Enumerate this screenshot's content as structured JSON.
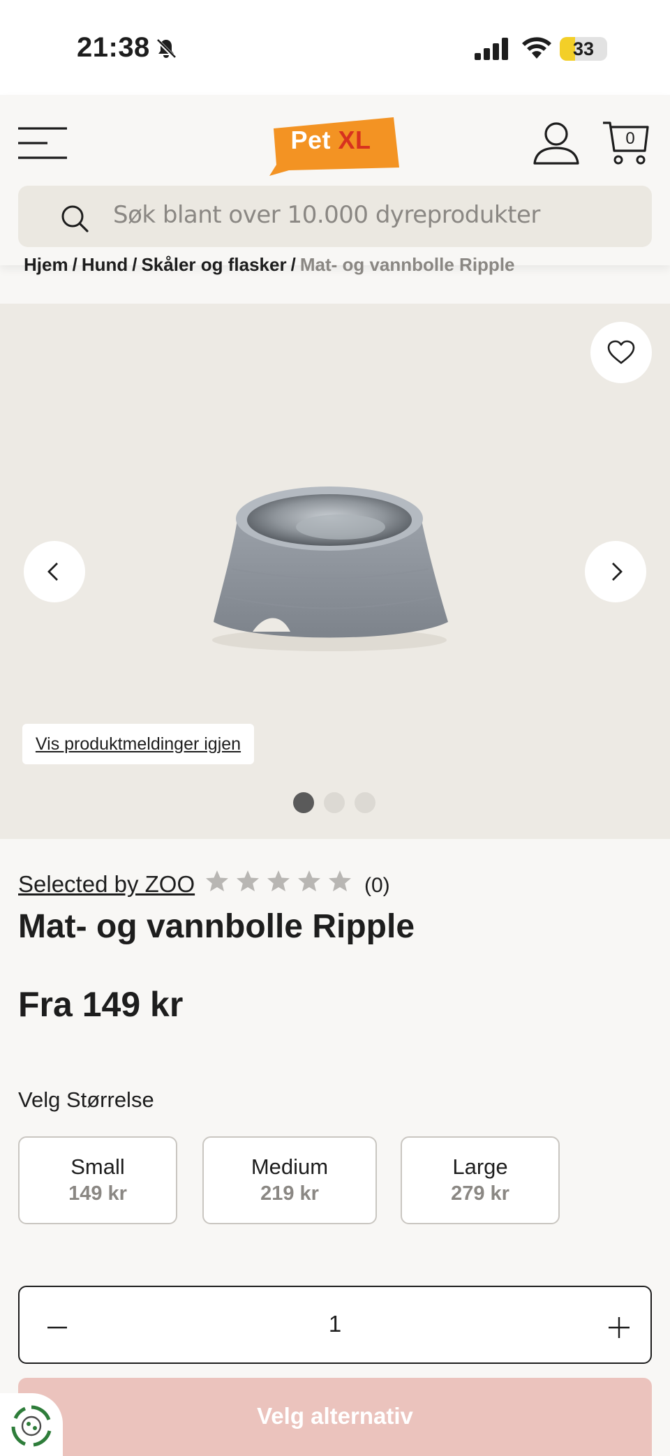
{
  "status_bar": {
    "time": "21:38",
    "battery": "33",
    "battery_level": 0.33
  },
  "header": {
    "logo": {
      "word1": "Pet",
      "word2": "XL"
    },
    "cart_count": "0",
    "icons": [
      "menu-icon",
      "user-icon",
      "cart-icon",
      "search-icon"
    ]
  },
  "search": {
    "placeholder": "Søk blant over 10.000 dyreprodukter"
  },
  "breadcrumb": {
    "items": [
      "Hjem",
      "Hund",
      "Skåler og flasker"
    ],
    "separator": "/",
    "current": "Mat- og vannbolle Ripple"
  },
  "gallery": {
    "notice_button": "Vis produktmeldinger igjen",
    "slide_count": 3,
    "active_slide": 1,
    "icons": [
      "heart-icon",
      "chevron-left-icon",
      "chevron-right-icon"
    ]
  },
  "product": {
    "brand": "Selected by ZOO",
    "rating_stars": 0,
    "rating_max": 5,
    "review_count": "(0)",
    "title": "Mat- og vannbolle Ripple",
    "price": "Fra 149 kr"
  },
  "size": {
    "label": "Velg Størrelse",
    "options": [
      {
        "name": "Small",
        "price": "149 kr"
      },
      {
        "name": "Medium",
        "price": "219 kr"
      },
      {
        "name": "Large",
        "price": "279 kr"
      }
    ]
  },
  "quantity": {
    "value": "1"
  },
  "cta": {
    "label": "Velg alternativ"
  },
  "colors": {
    "brand_orange": "#f39323",
    "brand_red": "#d7321f",
    "cta_disabled": "#ebc3bd",
    "battery_yellow": "#f3cf28"
  }
}
